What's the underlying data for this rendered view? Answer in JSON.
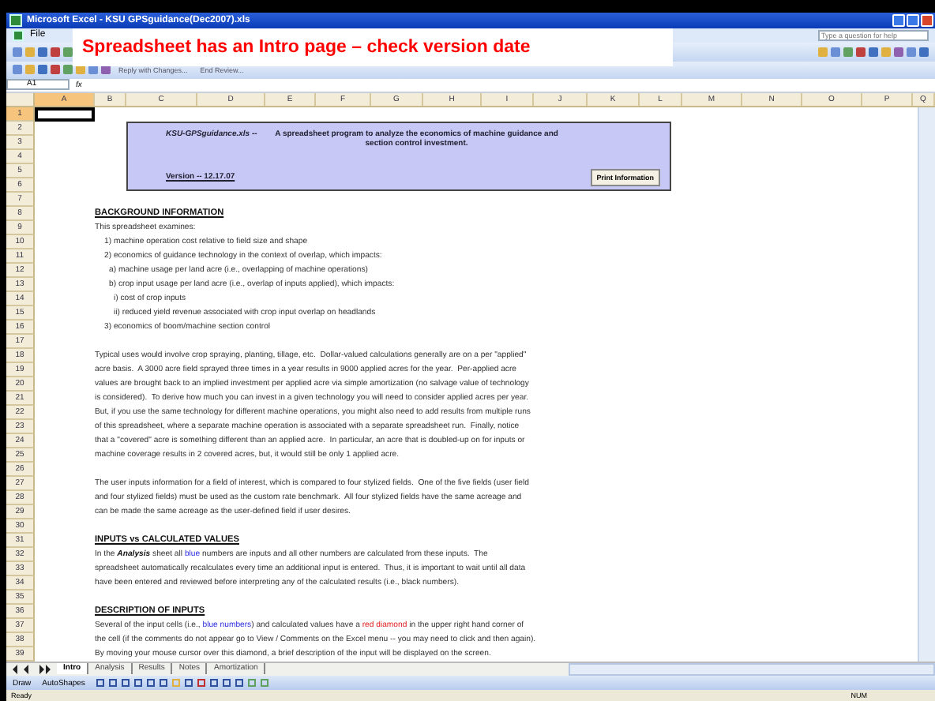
{
  "window": {
    "title": "Microsoft Excel - KSU GPSguidance(Dec2007).xls"
  },
  "callout": {
    "text": "Spreadsheet has an Intro page – check version date"
  },
  "menu": [
    "File"
  ],
  "help": {
    "placeholder": "Type a question for help"
  },
  "review_toolbar": {
    "label": "Reply with Changes...",
    "end": "End Review..."
  },
  "name_box": "A1",
  "formula_label": "fx",
  "columns": [
    {
      "label": "A",
      "selected": true
    },
    {
      "label": "B",
      "selected": false
    },
    {
      "label": "C",
      "selected": false
    },
    {
      "label": "D",
      "selected": false
    },
    {
      "label": "E",
      "selected": false
    },
    {
      "label": "F",
      "selected": false
    },
    {
      "label": "G",
      "selected": false
    },
    {
      "label": "H",
      "selected": false
    },
    {
      "label": "I",
      "selected": false
    },
    {
      "label": "J",
      "selected": false
    },
    {
      "label": "K",
      "selected": false
    },
    {
      "label": "L",
      "selected": false
    },
    {
      "label": "M",
      "selected": false
    },
    {
      "label": "N",
      "selected": false
    },
    {
      "label": "O",
      "selected": false
    },
    {
      "label": "P",
      "selected": false
    },
    {
      "label": "Q",
      "selected": false
    }
  ],
  "rows": [
    {
      "number": "1",
      "selected": true
    },
    {
      "number": "2",
      "selected": false,
      "kind": "banner",
      "banner": {
        "file": "KSU-GPSguidance.xls --",
        "description": "A spreadsheet program to analyze the economics of machine guidance and section control investment.",
        "version": "Version -- 12.17.07",
        "button": "Print Information"
      }
    },
    {
      "number": "3",
      "selected": false
    },
    {
      "number": "4",
      "selected": false
    },
    {
      "number": "5",
      "selected": false
    },
    {
      "number": "6",
      "selected": false
    },
    {
      "number": "7",
      "selected": false
    },
    {
      "number": "8",
      "selected": false,
      "kind": "heading",
      "parts": [
        {
          "text": "BACKGROUND INFORMATION"
        }
      ]
    },
    {
      "number": "9",
      "selected": false,
      "kind": "text",
      "parts": [
        {
          "text": "This spreadsheet examines:"
        }
      ],
      "children": [
        {
          "number": "10",
          "selected": false,
          "kind": "text",
          "parts": [
            {
              "text": "1) machine operation cost relative to field size and shape"
            }
          ]
        },
        {
          "number": "11",
          "selected": false,
          "kind": "text",
          "parts": [
            {
              "text": "2) economics of guidance technology in the context of overlap, which impacts:"
            }
          ],
          "children": [
            {
              "number": "12",
              "selected": false,
              "kind": "text",
              "parts": [
                {
                  "text": "a) machine usage per land acre (i.e., overlapping of machine operations)"
                }
              ]
            },
            {
              "number": "13",
              "selected": false,
              "kind": "text",
              "parts": [
                {
                  "text": "b) crop input usage per land acre (i.e., overlap of inputs applied), which impacts:"
                }
              ],
              "children": [
                {
                  "number": "14",
                  "selected": false,
                  "kind": "text",
                  "parts": [
                    {
                      "text": "i) cost of crop inputs"
                    }
                  ]
                },
                {
                  "number": "15",
                  "selected": false,
                  "kind": "text",
                  "parts": [
                    {
                      "text": "ii) reduced yield revenue associated with crop input overlap on headlands"
                    }
                  ]
                }
              ]
            }
          ]
        },
        {
          "number": "16",
          "selected": false,
          "kind": "text",
          "parts": [
            {
              "text": "3) economics of boom/machine section control"
            }
          ]
        }
      ]
    },
    {
      "number": "17",
      "selected": false
    },
    {
      "number": "18",
      "selected": false,
      "kind": "text",
      "parts": [
        {
          "text": "Typical uses would involve crop spraying, planting, tillage, etc.  Dollar-valued calculations generally are on a per \"applied\""
        }
      ]
    },
    {
      "number": "19",
      "selected": false,
      "kind": "text",
      "parts": [
        {
          "text": "acre basis.  A 3000 acre field sprayed three times in a year results in 9000 applied acres for the year.  Per-applied acre"
        }
      ]
    },
    {
      "number": "20",
      "selected": false,
      "kind": "text",
      "parts": [
        {
          "text": "values are brought back to an implied investment per applied acre via simple amortization (no salvage value of technology"
        }
      ]
    },
    {
      "number": "21",
      "selected": false,
      "kind": "text",
      "parts": [
        {
          "text": "is considered).  To derive how much you can invest in a given technology you will need to consider applied acres per year."
        }
      ]
    },
    {
      "number": "22",
      "selected": false,
      "kind": "text",
      "parts": [
        {
          "text": "But, if you use the same technology for different machine operations, you might also need to add results from multiple runs"
        }
      ]
    },
    {
      "number": "23",
      "selected": false,
      "kind": "text",
      "parts": [
        {
          "text": "of this spreadsheet, where a separate machine operation is associated with a separate spreadsheet run.  Finally, notice"
        }
      ]
    },
    {
      "number": "24",
      "selected": false,
      "kind": "text",
      "parts": [
        {
          "text": "that a \"covered\" acre is something different than an applied acre.  In particular, an acre that is doubled-up on for inputs or"
        }
      ]
    },
    {
      "number": "25",
      "selected": false,
      "kind": "text",
      "parts": [
        {
          "text": "machine coverage results in 2 covered acres, but, it would still be only 1 applied acre."
        }
      ]
    },
    {
      "number": "26",
      "selected": false
    },
    {
      "number": "27",
      "selected": false,
      "kind": "text",
      "parts": [
        {
          "text": "The user inputs information for a field of interest, which is compared to four stylized fields.  One of the five fields (user field"
        }
      ]
    },
    {
      "number": "28",
      "selected": false,
      "kind": "text",
      "parts": [
        {
          "text": "and four stylized fields) must be used as the custom rate benchmark.  All four stylized fields have the same acreage and"
        }
      ]
    },
    {
      "number": "29",
      "selected": false,
      "kind": "text",
      "parts": [
        {
          "text": "can be made the same acreage as the user-defined field if user desires."
        }
      ]
    },
    {
      "number": "30",
      "selected": false
    },
    {
      "number": "31",
      "selected": false,
      "kind": "heading",
      "parts": [
        {
          "text": "INPUTS vs CALCULATED VALUES"
        }
      ]
    },
    {
      "number": "32",
      "selected": false,
      "kind": "text",
      "parts": [
        {
          "text": "In the **Analysis** sheet all "
        },
        {
          "text": "blue",
          "kind": "input"
        },
        {
          "text": " numbers are inputs and all other numbers are calculated from these inputs.  The"
        }
      ]
    },
    {
      "number": "33",
      "selected": false,
      "kind": "text",
      "parts": [
        {
          "text": "spreadsheet automatically recalculates every time an additional input is entered.  Thus, it is important to wait until all data"
        }
      ]
    },
    {
      "number": "34",
      "selected": false,
      "kind": "text",
      "parts": [
        {
          "text": "have been entered and reviewed before interpreting any of the calculated results (i.e., black numbers)."
        }
      ]
    },
    {
      "number": "35",
      "selected": false
    },
    {
      "number": "36",
      "selected": false,
      "kind": "heading",
      "parts": [
        {
          "text": "DESCRIPTION OF INPUTS"
        }
      ]
    },
    {
      "number": "37",
      "selected": false,
      "kind": "text",
      "parts": [
        {
          "text": "Several of the input cells (i.e., "
        },
        {
          "text": "blue numbers",
          "kind": "input"
        },
        {
          "text": ") and calculated values have a "
        },
        {
          "text": "red diamond",
          "kind": "marker"
        },
        {
          "text": " in the upper right hand corner of"
        }
      ]
    },
    {
      "number": "38",
      "selected": false,
      "kind": "text",
      "parts": [
        {
          "text": "the cell (if the comments do not appear go to View / Comments on the Excel menu -- you may need to click and then again)."
        }
      ]
    },
    {
      "number": "39",
      "selected": false,
      "kind": "text",
      "parts": [
        {
          "text": "By moving your mouse cursor over this diamond, a brief description of the input will be displayed on the screen."
        }
      ]
    }
  ],
  "sheet_tabs": [
    {
      "label": "Intro",
      "selected": true
    },
    {
      "label": "Analysis",
      "selected": false
    },
    {
      "label": "Results",
      "selected": false
    },
    {
      "label": "Notes",
      "selected": false
    },
    {
      "label": "Amortization",
      "selected": false
    }
  ],
  "drawing_toolbar": {
    "draw": "Draw",
    "autoshapes": "AutoShapes"
  },
  "status_bar": {
    "left": "Ready",
    "right": "NUM"
  }
}
